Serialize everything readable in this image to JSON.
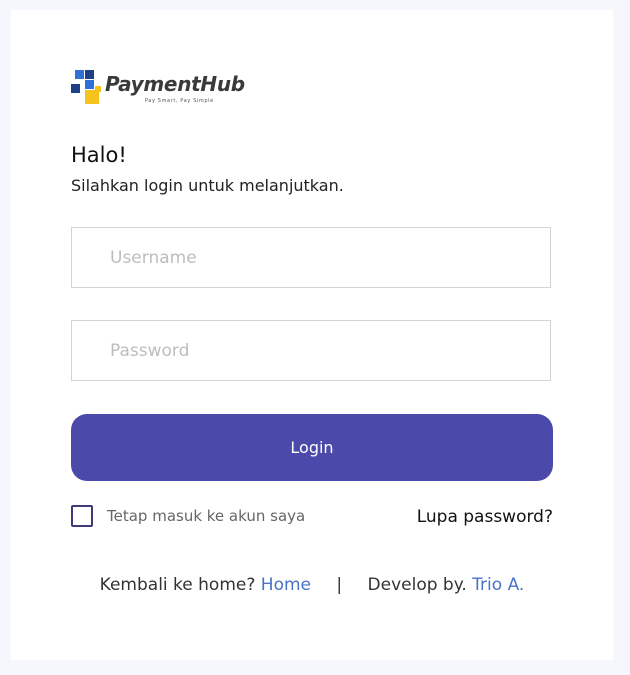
{
  "brand": {
    "name": "PaymentHub",
    "tagline": "Pay Smart, Pay Simple",
    "colors": {
      "blue": "#2f6fd8",
      "navy": "#1f3f86",
      "yellow": "#f6c21c"
    }
  },
  "login": {
    "greeting": "Halo!",
    "subtitle": "Silahkan login untuk melanjutkan.",
    "username_placeholder": "Username",
    "password_placeholder": "Password",
    "login_label": "Login",
    "remember_label": "Tetap masuk ke akun saya",
    "remember_checked": false,
    "forgot_label": "Lupa password?",
    "button_color": "#4b4aaa"
  },
  "footer": {
    "home_prefix": "Kembali ke home?",
    "home_link": "Home",
    "separator": "|",
    "dev_prefix": "Develop by.",
    "dev_link": "Trio A.",
    "link_color": "#4a72c9"
  }
}
